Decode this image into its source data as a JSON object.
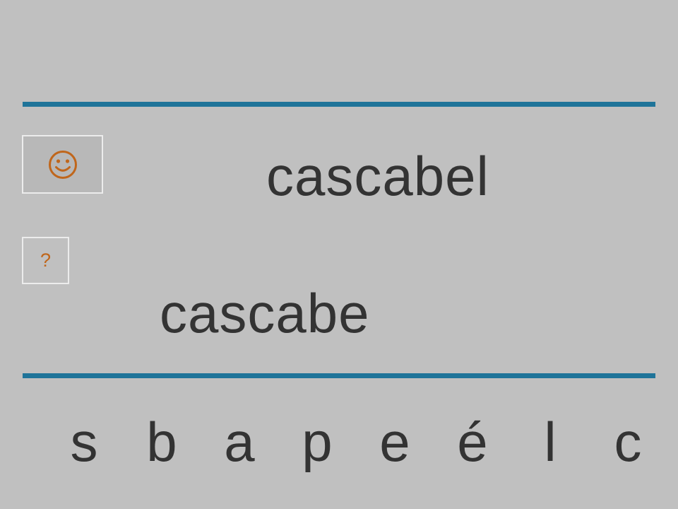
{
  "target_word": "cascabel",
  "typed_word": "cascabe",
  "hint_label": "?",
  "smiley_icon": "smiley-face-icon",
  "letters": [
    "s",
    "b",
    "a",
    "p",
    "e",
    "é",
    "l",
    "c"
  ],
  "colors": {
    "background": "#c0c0c0",
    "rule": "#1f7499",
    "text": "#333333",
    "accent": "#c0661b",
    "box_border": "#ececec"
  }
}
